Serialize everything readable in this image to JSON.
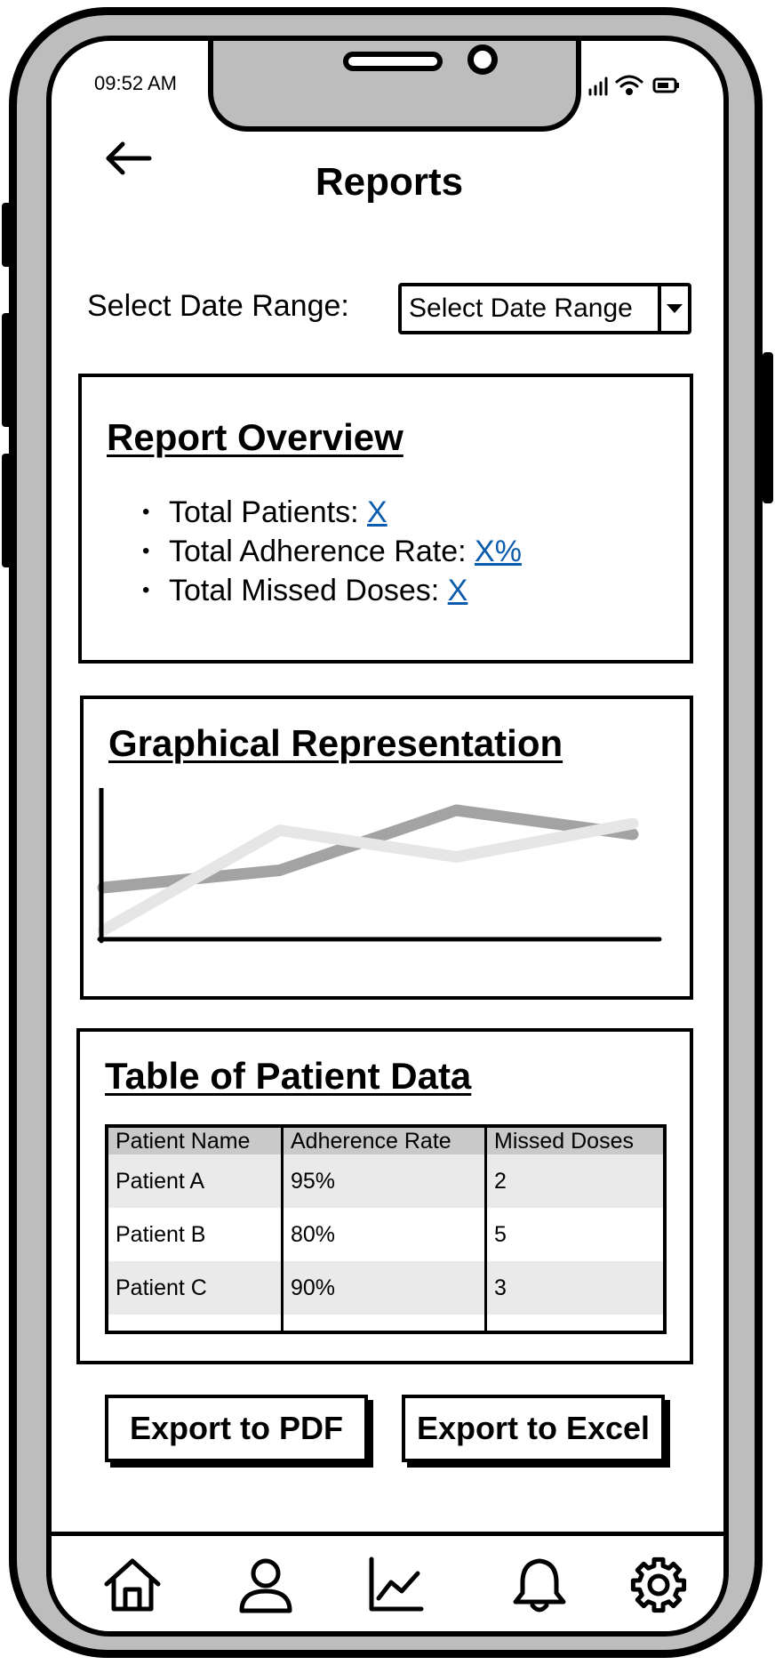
{
  "status_bar": {
    "time": "09:52 AM",
    "icons": [
      "signal-icon",
      "wifi-icon",
      "battery-icon"
    ]
  },
  "header": {
    "back_icon": "back-arrow-icon",
    "title": "Reports"
  },
  "date_range": {
    "label": "Select Date Range:",
    "selected": "Select Date Range"
  },
  "overview": {
    "title": "Report Overview",
    "items": [
      {
        "label": "Total Patients: ",
        "value": "X"
      },
      {
        "label": "Total Adherence Rate: ",
        "value": "X%"
      },
      {
        "label": "Total Missed Doses: ",
        "value": "X"
      }
    ]
  },
  "graph": {
    "title": "Graphical Representation",
    "colors": {
      "series_light": "#e6e6e6",
      "series_dark": "#a3a3a3",
      "axis": "#000000"
    }
  },
  "chart_data": {
    "type": "line",
    "x": [
      0,
      1,
      2,
      3
    ],
    "series": [
      {
        "values": [
          0,
          0.75,
          0.55,
          0.8
        ]
      },
      {
        "values": [
          0.32,
          0.45,
          0.9,
          0.72
        ]
      }
    ],
    "ylim": [
      0,
      1
    ],
    "grid": false
  },
  "table": {
    "title": "Table of Patient Data",
    "columns": [
      "Patient Name",
      "Adherence Rate",
      "Missed Doses"
    ],
    "rows": [
      [
        "Patient A",
        "95%",
        "2"
      ],
      [
        "Patient B",
        "80%",
        "5"
      ],
      [
        "Patient C",
        "90%",
        "3"
      ]
    ]
  },
  "actions": {
    "export_pdf": "Export to PDF",
    "export_excel": "Export to Excel"
  },
  "bottom_nav": {
    "items": [
      "home-icon",
      "profile-icon",
      "analytics-icon",
      "notifications-icon",
      "settings-icon"
    ]
  }
}
